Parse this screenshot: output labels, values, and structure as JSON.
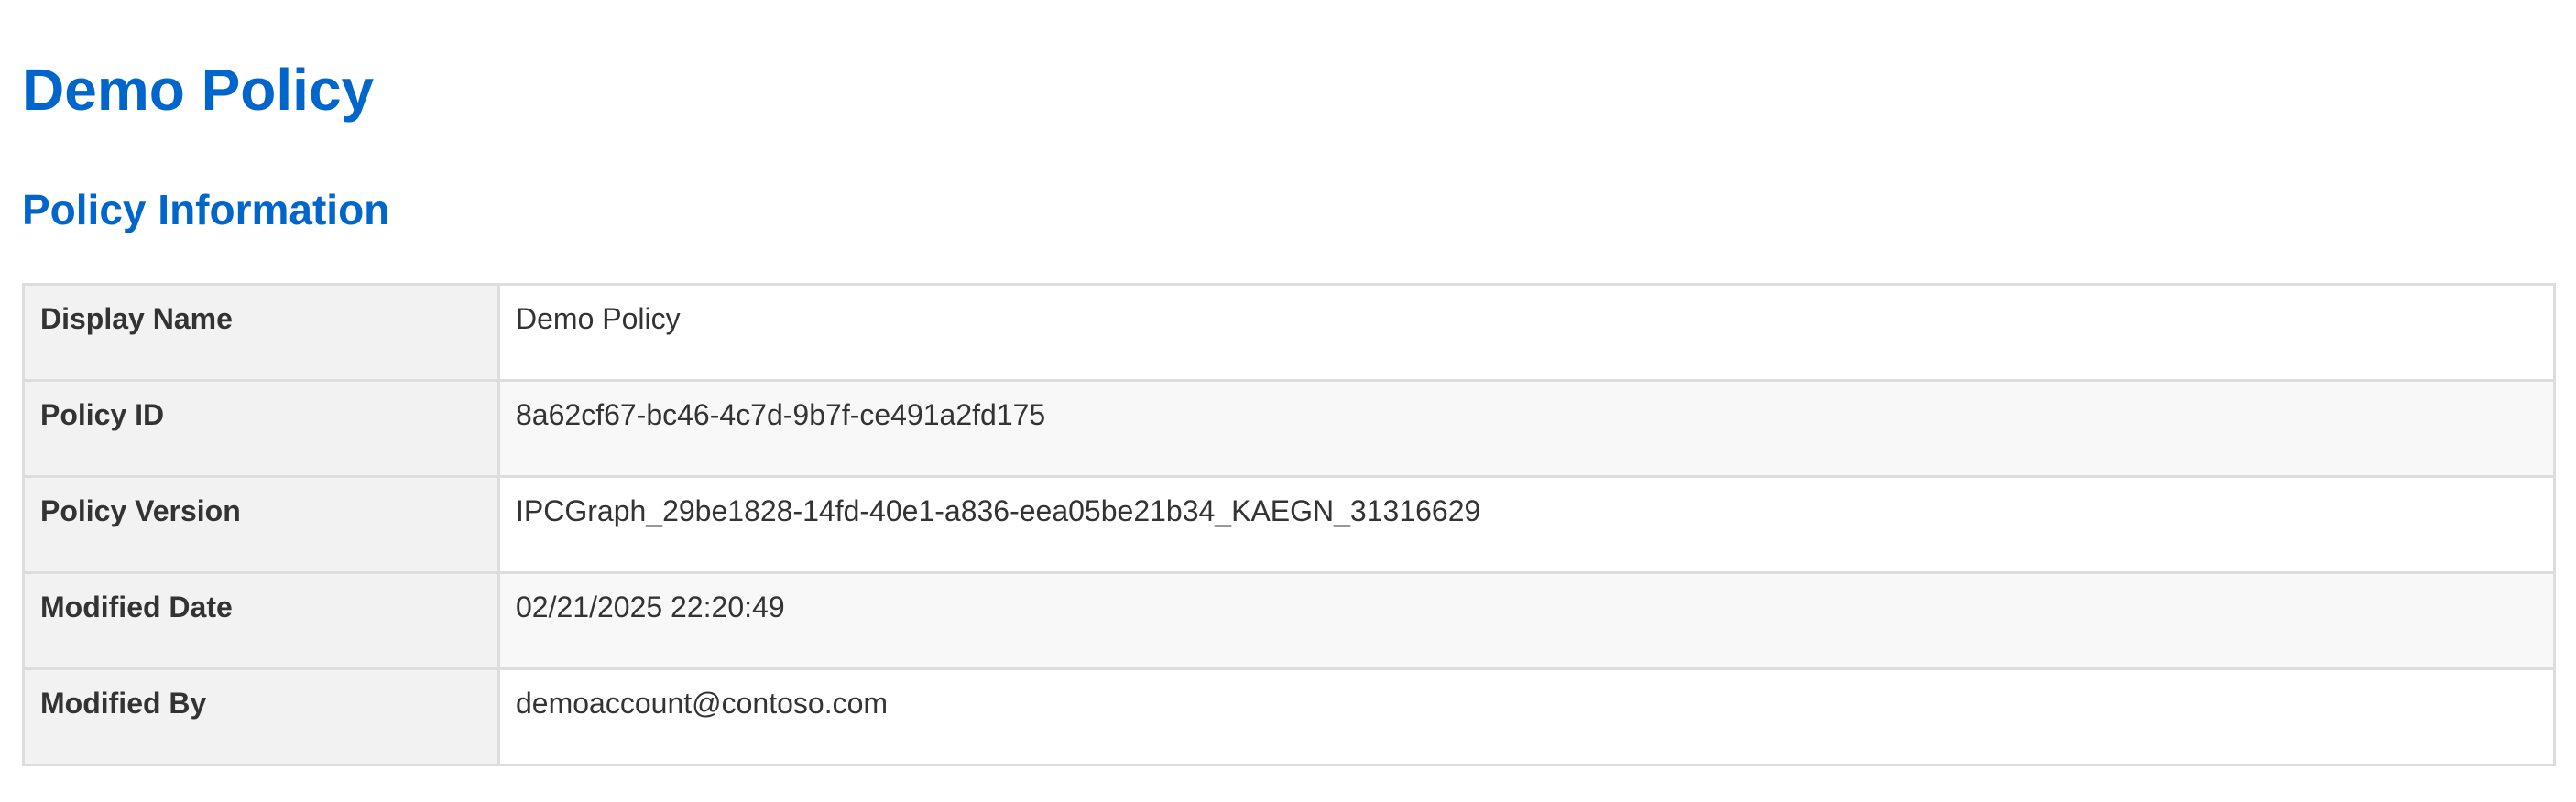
{
  "page": {
    "title": "Demo Policy",
    "section_title": "Policy Information",
    "title_color": "#0066cc"
  },
  "policy_info": {
    "rows": [
      {
        "label": "Display Name",
        "value": "Demo Policy"
      },
      {
        "label": "Policy ID",
        "value": "8a62cf67-bc46-4c7d-9b7f-ce491a2fd175"
      },
      {
        "label": "Policy Version",
        "value": "IPCGraph_29be1828-14fd-40e1-a836-eea05be21b34_KAEGN_31316629"
      },
      {
        "label": "Modified Date",
        "value": "02/21/2025 22:20:49"
      },
      {
        "label": "Modified By",
        "value": "demoaccount@contoso.com"
      }
    ]
  }
}
